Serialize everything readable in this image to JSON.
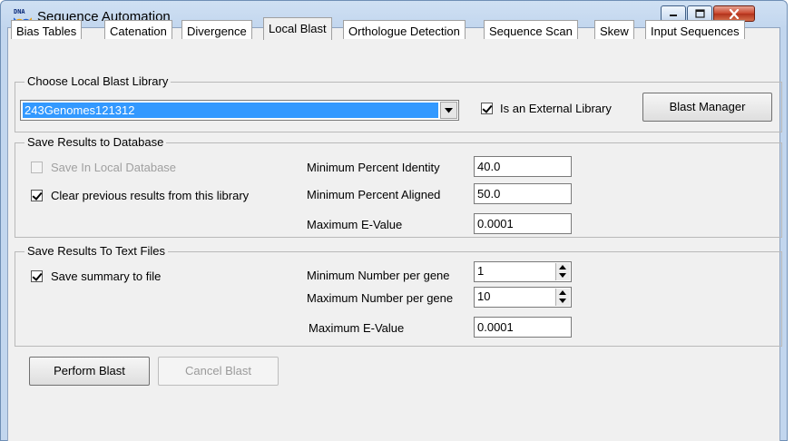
{
  "window": {
    "title": "Sequence Automation",
    "icon": "dna-app-icon",
    "icon_text": "DNA"
  },
  "tabs": [
    {
      "label": "Bias Tables"
    },
    {
      "label": "Catenation"
    },
    {
      "label": "Divergence"
    },
    {
      "label": "Local Blast",
      "active": true
    },
    {
      "label": "Orthologue Detection"
    },
    {
      "label": "Sequence Scan"
    },
    {
      "label": "Skew"
    },
    {
      "label": "Input Sequences"
    }
  ],
  "library": {
    "legend": "Choose Local Blast Library",
    "selected": "243Genomes121312",
    "external_label": "Is an External Library",
    "external_checked": true,
    "manager_button": "Blast Manager"
  },
  "database": {
    "legend": "Save Results to Database",
    "save_local_label": "Save In Local Database",
    "save_local_checked": false,
    "save_local_enabled": false,
    "clear_label": "Clear previous results from this library",
    "clear_checked": true,
    "min_identity_label": "Minimum Percent Identity",
    "min_identity_value": "40.0",
    "min_aligned_label": "Minimum Percent Aligned",
    "min_aligned_value": "50.0",
    "max_evalue_label": "Maximum E-Value",
    "max_evalue_value": "0.0001"
  },
  "textfiles": {
    "legend": "Save Results To Text Files",
    "summary_label": "Save summary to file",
    "summary_checked": true,
    "min_per_gene_label": "Minimum Number per gene",
    "min_per_gene_value": "1",
    "max_per_gene_label": "Maximum Number per gene",
    "max_per_gene_value": "10",
    "max_evalue_label": "Maximum E-Value",
    "max_evalue_value": "0.0001"
  },
  "actions": {
    "perform_label": "Perform Blast",
    "cancel_label": "Cancel Blast",
    "cancel_enabled": false
  },
  "colors": {
    "selection": "#3399ff",
    "close_button": "#c9452c"
  }
}
